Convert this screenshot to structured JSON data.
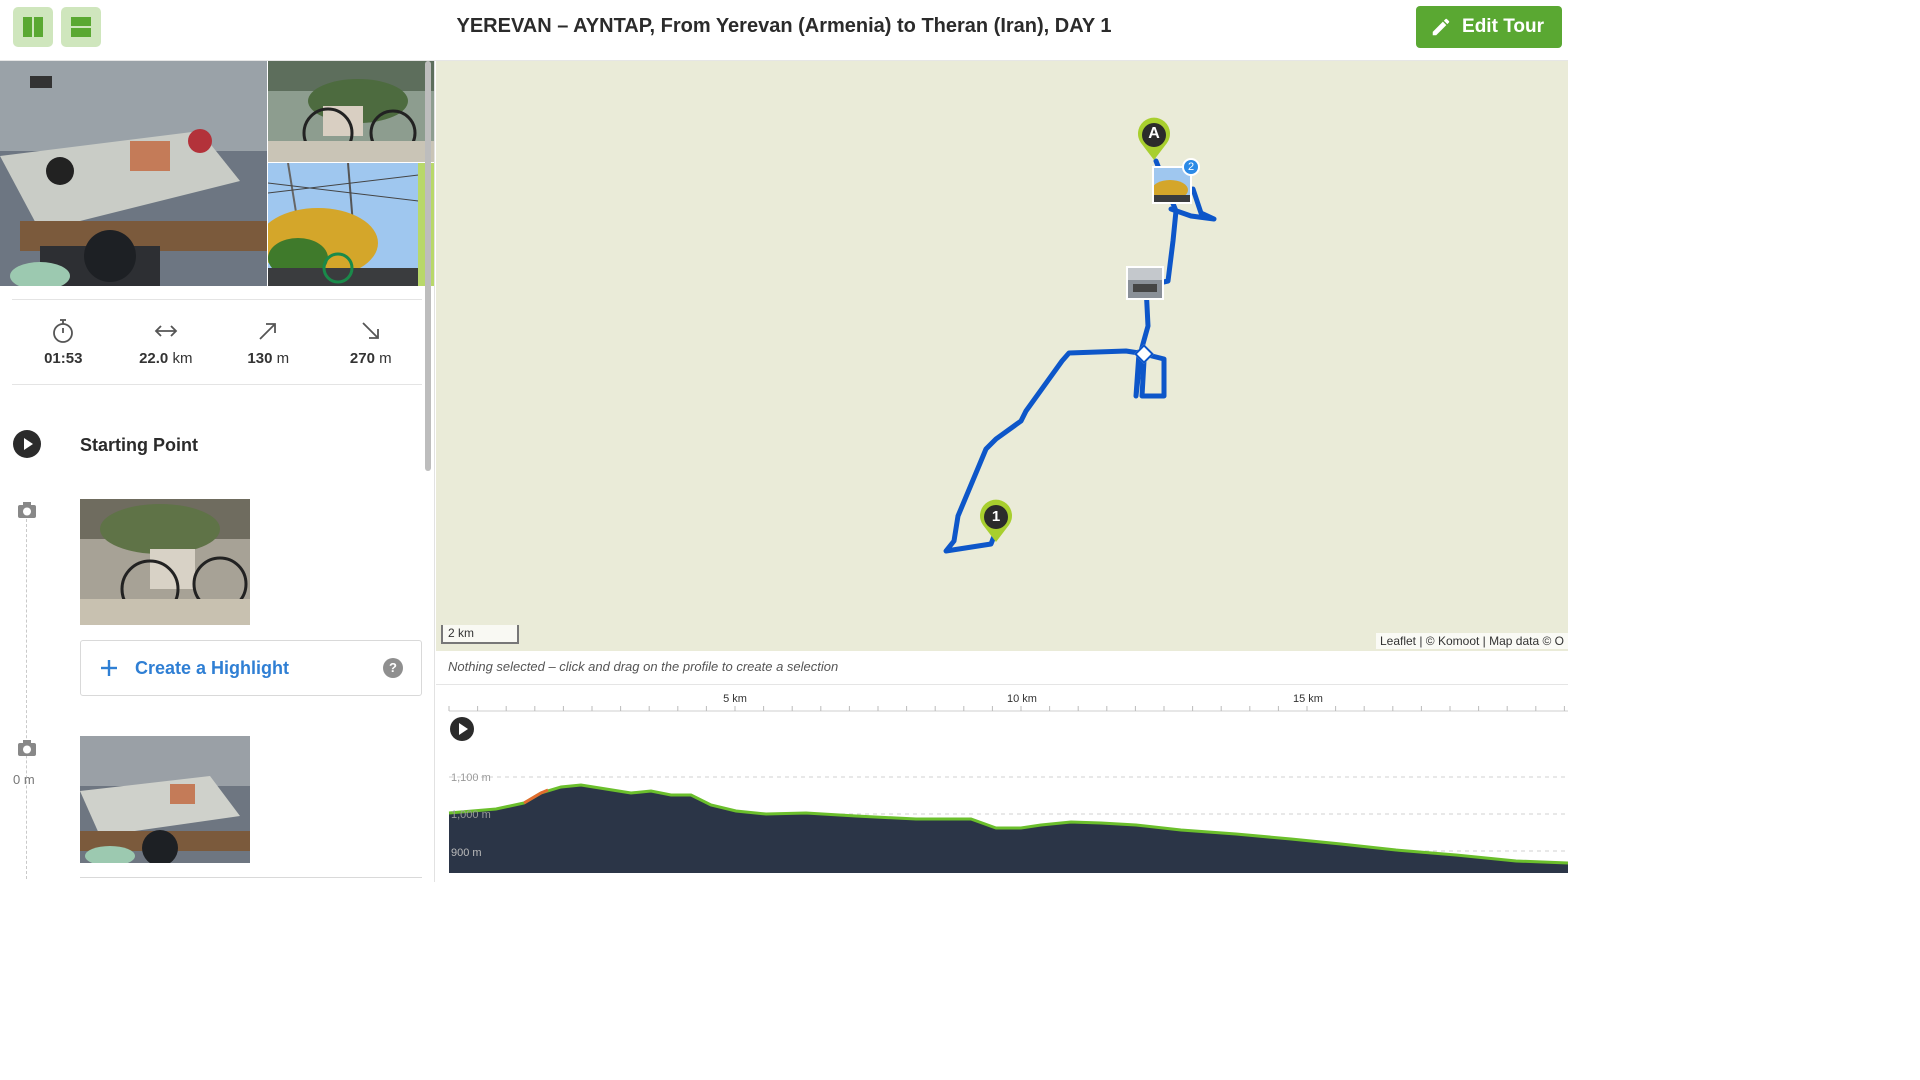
{
  "header": {
    "title": "YEREVAN – AYNTAP, From Yerevan (Armenia) to Theran (Iran), DAY 1",
    "edit_label": "Edit Tour"
  },
  "stats": [
    {
      "icon": "stopwatch-icon",
      "value": "01:53",
      "unit": ""
    },
    {
      "icon": "distance-arrows-icon",
      "value": "22.0",
      "unit": "km"
    },
    {
      "icon": "uphill-arrow-icon",
      "value": "130",
      "unit": "m"
    },
    {
      "icon": "downhill-arrow-icon",
      "value": "270",
      "unit": "m"
    }
  ],
  "timeline": {
    "start_label": "Starting Point",
    "highlight_label": "Create a Highlight",
    "help_glyph": "?",
    "distance_label": "0 m"
  },
  "map": {
    "marker_start": "A",
    "marker_waypoint": "1",
    "photo_cluster_count": "2",
    "scale_label": "2 km",
    "attribution": "Leaflet | © Komoot | Map data © O"
  },
  "profile": {
    "hint": "Nothing selected – click and drag on the profile to create a selection",
    "km_labels": [
      "5 km",
      "10 km",
      "15 km"
    ],
    "elev_labels": [
      "1,100 m",
      "1,000 m",
      "900 m"
    ]
  },
  "colors": {
    "accent_green": "#5aa832",
    "route_blue": "#0d56c9",
    "link_blue": "#2f7fd4",
    "profile_fill": "#2b3547",
    "map_bg": "#eaebd8"
  }
}
